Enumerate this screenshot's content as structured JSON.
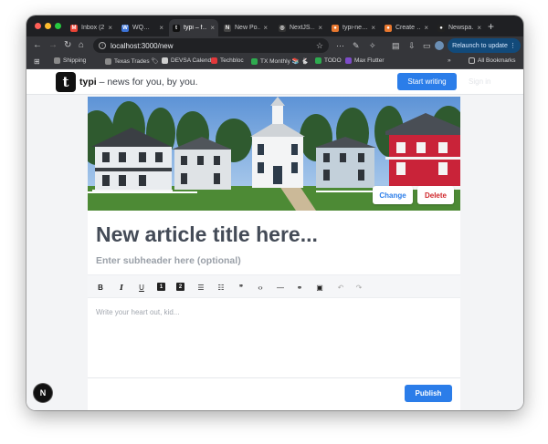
{
  "browser": {
    "tabs": [
      {
        "label": "Inbox (2…",
        "fav": "M",
        "color": "#ea4335"
      },
      {
        "label": "WQ…",
        "fav": "W",
        "color": "#3b73d8"
      },
      {
        "label": "typi – f…",
        "fav": "t",
        "color": "#111111",
        "active": true
      },
      {
        "label": "New Po…",
        "fav": "N",
        "color": "#444444"
      },
      {
        "label": "NextJS…",
        "fav": "◎",
        "color": "#333333"
      },
      {
        "label": "typi-ne…",
        "fav": "●",
        "color": "#e8772e"
      },
      {
        "label": "Create …",
        "fav": "●",
        "color": "#e8772e"
      },
      {
        "label": "Newspa…",
        "fav": "●",
        "color": "#222222"
      }
    ],
    "url": "localhost:3000/new",
    "relaunch_label": "Relaunch to update",
    "bookmarks": [
      {
        "label": "Shipping",
        "color": "#8a8a8a"
      },
      {
        "label": "Texas Trades 🏷",
        "color": "#8a8a8a"
      },
      {
        "label": "DEVSA Calendar",
        "color": "#cfcfcf"
      },
      {
        "label": "Techbloc",
        "color": "#e2383b"
      },
      {
        "label": "TX Monthly 📚 🐇",
        "color": "#2eab4f"
      },
      {
        "label": "TODO",
        "color": "#2eab4f"
      },
      {
        "label": "Max Flutter",
        "color": "#7d4cc9"
      }
    ],
    "all_bookmarks": "All Bookmarks"
  },
  "site": {
    "logo": "t",
    "brand_name": "typi",
    "tagline": " – news for you, by you.",
    "start_writing": "Start writing",
    "sign_in": "Sign in"
  },
  "editor": {
    "change_label": "Change",
    "delete_label": "Delete",
    "title_placeholder": "New article title here...",
    "subtitle_placeholder": "Enter subheader here (optional)",
    "body_placeholder": "Write your heart out, kid...",
    "publish_label": "Publish",
    "toolbar": [
      {
        "name": "bold-button",
        "glyph": "B",
        "style": "bold"
      },
      {
        "name": "italic-button",
        "glyph": "I",
        "style": "italic"
      },
      {
        "name": "underline-button",
        "glyph": "U",
        "style": "underline"
      },
      {
        "name": "heading-1-button",
        "glyph": "1",
        "style": "box"
      },
      {
        "name": "heading-2-button",
        "glyph": "2",
        "style": "box"
      },
      {
        "name": "bullet-list-button",
        "glyph": "☰",
        "style": "plain"
      },
      {
        "name": "ordered-list-button",
        "glyph": "☷",
        "style": "plain"
      },
      {
        "name": "blockquote-button",
        "glyph": "❞",
        "style": "plain"
      },
      {
        "name": "code-button",
        "glyph": "‹›",
        "style": "plain"
      },
      {
        "name": "horizontal-rule-button",
        "glyph": "—",
        "style": "plain"
      },
      {
        "name": "link-button",
        "glyph": "⚭",
        "style": "plain"
      },
      {
        "name": "image-button",
        "glyph": "▣",
        "style": "plain"
      },
      {
        "name": "undo-button",
        "glyph": "↶",
        "style": "dim"
      },
      {
        "name": "redo-button",
        "glyph": "↷",
        "style": "dim"
      }
    ]
  },
  "colors": {
    "accent": "#2b7de9",
    "delete": "#d0262a",
    "change": "#2b7de9"
  },
  "badge": "N"
}
